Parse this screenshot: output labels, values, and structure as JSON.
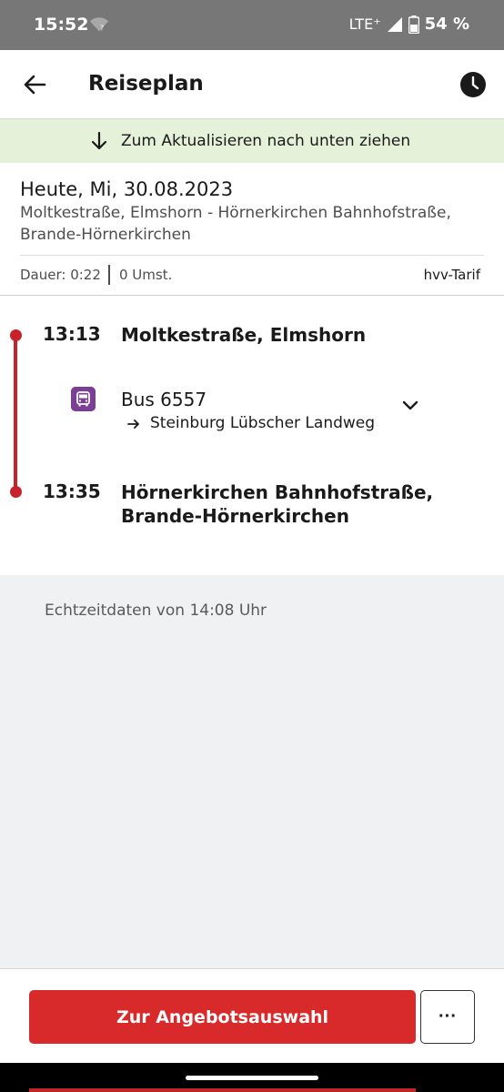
{
  "status_bar": {
    "time": "15:52",
    "network": "LTE⁺",
    "battery": "54 %"
  },
  "app_bar": {
    "title": "Reiseplan"
  },
  "refresh_banner": {
    "text": "Zum Aktualisieren nach unten ziehen"
  },
  "journey": {
    "date": "Heute, Mi, 30.08.2023",
    "route": "Moltkestraße, Elmshorn - Hörnerkirchen Bahnhofstraße, Brande-Hörnerkirchen",
    "duration": "Dauer: 0:22",
    "transfers": "0 Umst.",
    "tariff": "hvv-Tarif"
  },
  "timeline": {
    "start": {
      "time": "13:13",
      "stop": "Moltkestraße, Elmshorn"
    },
    "leg": {
      "line": "Bus 6557",
      "direction": "Steinburg Lübscher Landweg"
    },
    "end": {
      "time": "13:35",
      "stop": "Hörnerkirchen Bahnhofstraße, Brande-Hörnerkirchen"
    }
  },
  "realtime_note": "Echtzeitdaten von 14:08 Uhr",
  "bottom": {
    "primary_label": "Zur Angebotsauswahl",
    "more_label": "···"
  },
  "colors": {
    "accent_red": "#d82a2a",
    "timeline_red": "#c6222a",
    "bus_purple": "#7b3f93",
    "banner_green": "#e6f1d9"
  },
  "icons": [
    "wifi-icon",
    "signal-icon",
    "battery-icon",
    "back-arrow-icon",
    "clock-icon",
    "down-arrow-icon",
    "bus-icon",
    "right-arrow-icon",
    "chevron-down-icon"
  ]
}
